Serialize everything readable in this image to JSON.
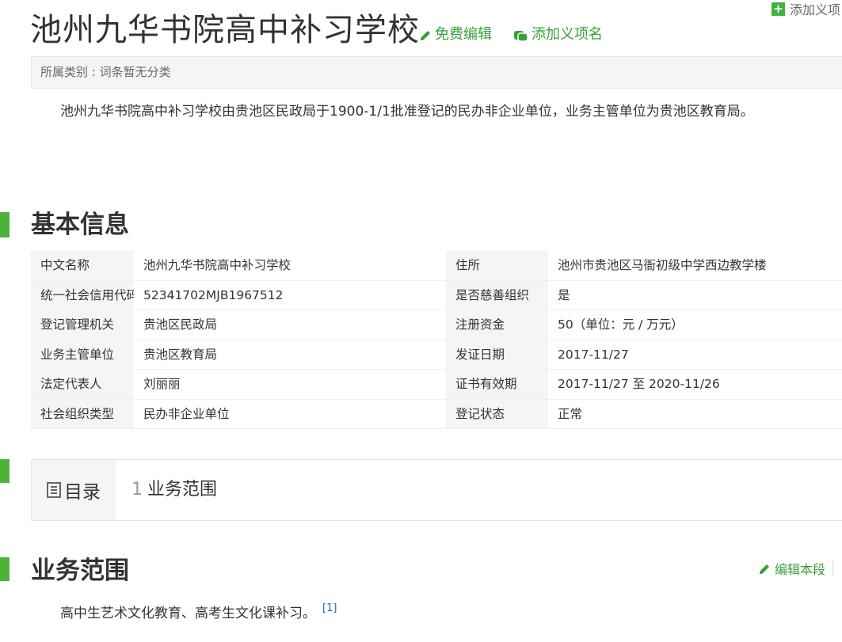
{
  "title": "池州九华书院高中补习学校",
  "actions": {
    "free_edit": "免费编辑",
    "add_term": "添加义项名",
    "top_add": "添加义项"
  },
  "category": "所属类别 : 词条暂无分类",
  "summary": "池州九华书院高中补习学校由贵池区民政局于1900-1/1批准登记的民办非企业单位，业务主管单位为贵池区教育局。",
  "basic_info": {
    "heading": "基本信息",
    "rows": [
      {
        "k1": "中文名称",
        "v1": "池州九华书院高中补习学校",
        "k2": "住所",
        "v2": "池州市贵池区马衙初级中学西边教学楼"
      },
      {
        "k1": "统一社会信用代码",
        "v1": "52341702MJB1967512",
        "k2": "是否慈善组织",
        "v2": "是"
      },
      {
        "k1": "登记管理机关",
        "v1": "贵池区民政局",
        "k2": "注册资金",
        "v2": "50（单位：元 / 万元）"
      },
      {
        "k1": "业务主管单位",
        "v1": "贵池区教育局",
        "k2": "发证日期",
        "v2": "2017-11/27"
      },
      {
        "k1": "法定代表人",
        "v1": "刘丽丽",
        "k2": "证书有效期",
        "v2": "2017-11/27 至 2020-11/26"
      },
      {
        "k1": "社会组织类型",
        "v1": "民办非企业单位",
        "k2": "登记状态",
        "v2": "正常"
      }
    ]
  },
  "toc": {
    "heading": "目录",
    "items": [
      {
        "num": "1",
        "label": "业务范围"
      }
    ]
  },
  "scope": {
    "heading": "业务范围",
    "edit_label": "编辑本段",
    "text": "高中生艺术文化教育、高考生文化课补习。",
    "ref": "[1]"
  },
  "colors": {
    "accent_green": "#4cb338",
    "link_green": "#3a9f3a",
    "ref_blue": "#136ec2"
  }
}
